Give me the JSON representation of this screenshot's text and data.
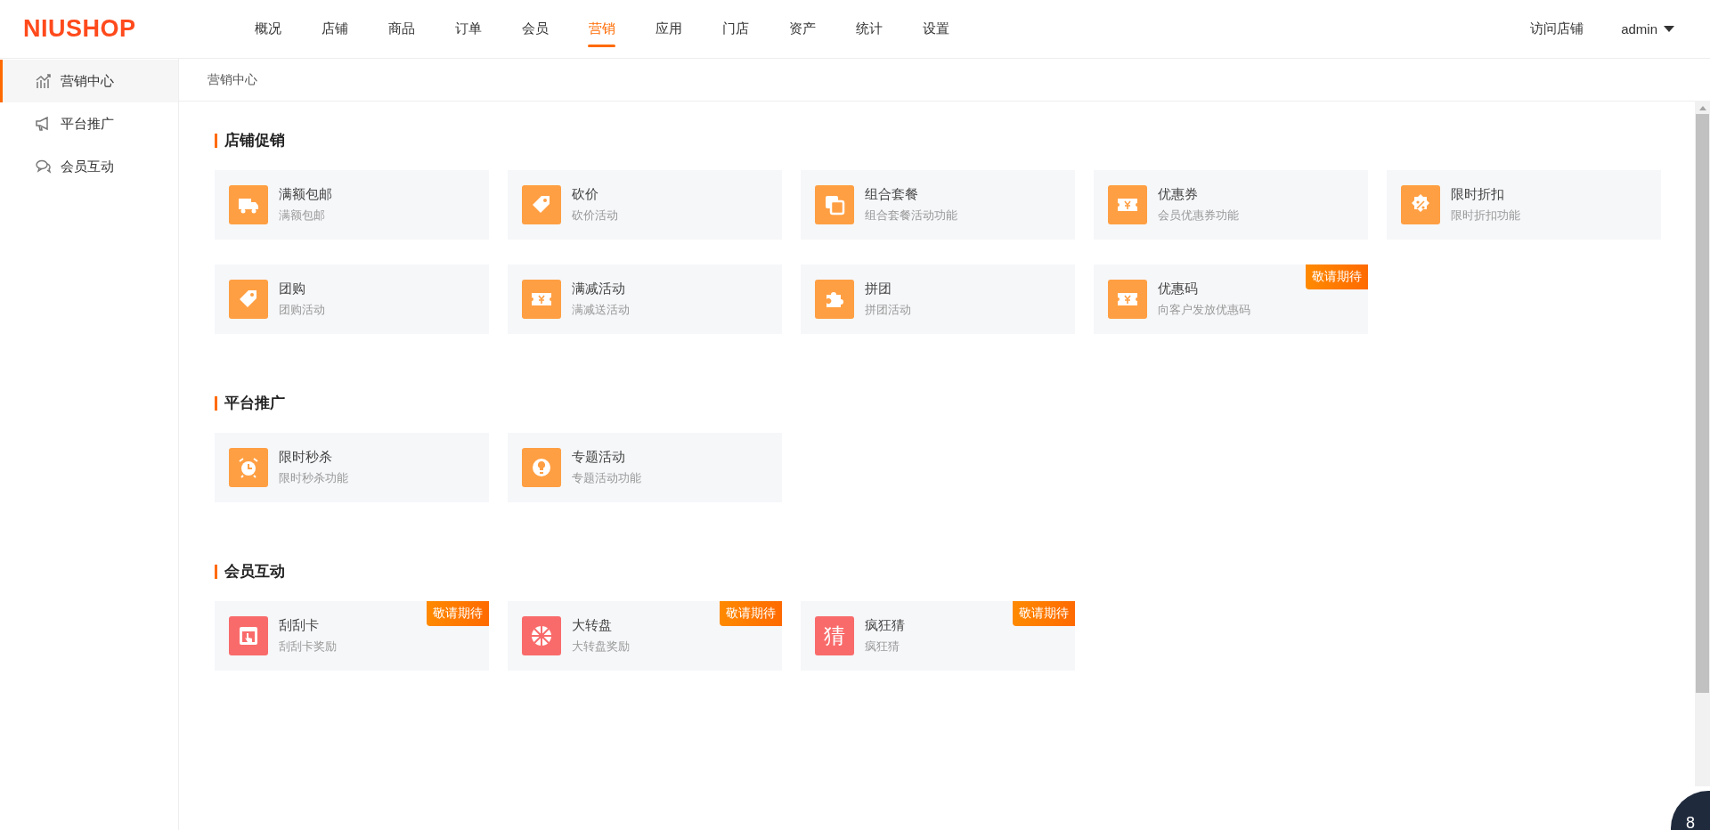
{
  "header": {
    "logo": "NIUSHOP",
    "nav": [
      {
        "label": "概况",
        "selected": false
      },
      {
        "label": "店铺",
        "selected": false
      },
      {
        "label": "商品",
        "selected": false
      },
      {
        "label": "订单",
        "selected": false
      },
      {
        "label": "会员",
        "selected": false
      },
      {
        "label": "营销",
        "selected": true
      },
      {
        "label": "应用",
        "selected": false
      },
      {
        "label": "门店",
        "selected": false
      },
      {
        "label": "资产",
        "selected": false
      },
      {
        "label": "统计",
        "selected": false
      },
      {
        "label": "设置",
        "selected": false
      }
    ],
    "visit_store": "访问店铺",
    "user": "admin"
  },
  "sidebar": {
    "items": [
      {
        "label": "营销中心",
        "selected": true
      },
      {
        "label": "平台推广",
        "selected": false
      },
      {
        "label": "会员互动",
        "selected": false
      }
    ]
  },
  "breadcrumb": "营销中心",
  "sections": [
    {
      "title": "店铺促销",
      "cards": [
        {
          "title": "满额包邮",
          "desc": "满额包邮",
          "color": "#ff9f43"
        },
        {
          "title": "砍价",
          "desc": "砍价活动",
          "color": "#ff9f43"
        },
        {
          "title": "组合套餐",
          "desc": "组合套餐活动功能",
          "color": "#ff9f43"
        },
        {
          "title": "优惠券",
          "desc": "会员优惠券功能",
          "color": "#ff9f43"
        },
        {
          "title": "限时折扣",
          "desc": "限时折扣功能",
          "color": "#ff9f43"
        },
        {
          "title": "团购",
          "desc": "团购活动",
          "color": "#ff9f43"
        },
        {
          "title": "满减活动",
          "desc": "满减送活动",
          "color": "#ff9f43"
        },
        {
          "title": "拼团",
          "desc": "拼团活动",
          "color": "#ff9f43"
        },
        {
          "title": "优惠码",
          "desc": "向客户发放优惠码",
          "color": "#ff9f43",
          "badge": "敬请期待"
        }
      ]
    },
    {
      "title": "平台推广",
      "cards": [
        {
          "title": "限时秒杀",
          "desc": "限时秒杀功能",
          "color": "#ff9f43"
        },
        {
          "title": "专题活动",
          "desc": "专题活动功能",
          "color": "#ff9f43"
        }
      ]
    },
    {
      "title": "会员互动",
      "cards": [
        {
          "title": "刮刮卡",
          "desc": "刮刮卡奖励",
          "color": "#f96b6b",
          "badge": "敬请期待"
        },
        {
          "title": "大转盘",
          "desc": "大转盘奖励",
          "color": "#f96b6b",
          "badge": "敬请期待"
        },
        {
          "title": "疯狂猜",
          "desc": "疯狂猜",
          "color": "#f96b6b",
          "badge": "敬请期待",
          "icon_text": "猜"
        }
      ]
    }
  ],
  "help_bubble": "8"
}
